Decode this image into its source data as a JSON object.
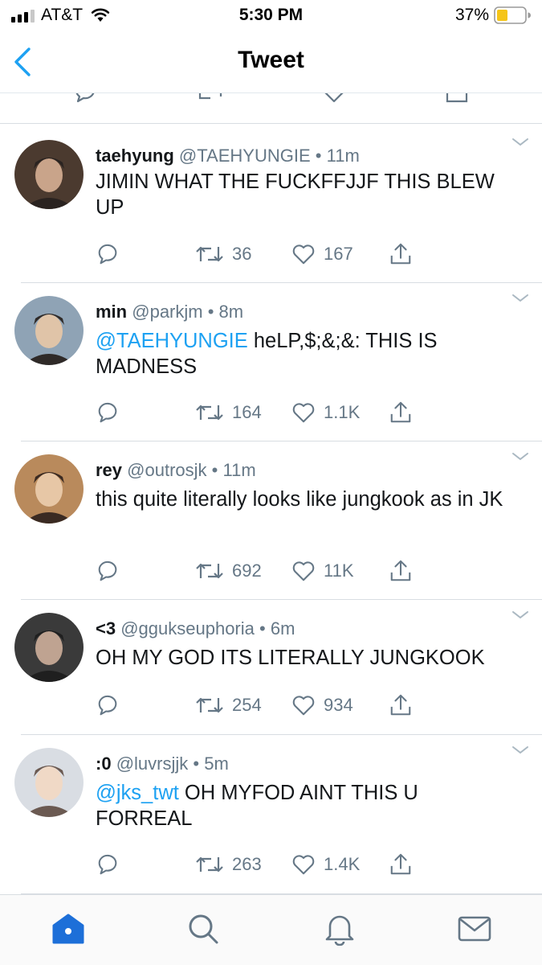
{
  "status_bar": {
    "carrier": "AT&T",
    "time": "5:30 PM",
    "battery": "37%"
  },
  "nav": {
    "title": "Tweet",
    "back_icon": "chevron-left-icon"
  },
  "colors": {
    "accent": "#1da1f2",
    "icon_blue": "#1d6fd8",
    "muted": "#657786",
    "divider": "#d8dde2",
    "battery_fill": "#f5c518"
  },
  "tweets": [
    {
      "name": "taehyung",
      "handle": "@TAEHYUNGIE",
      "sep": "•",
      "time": "11m",
      "mention": "",
      "text": "JIMIN WHAT THE FUCKFFJJF THIS BLEW UP",
      "retweets": "36",
      "likes": "167"
    },
    {
      "name": "min",
      "handle": "@parkjm",
      "sep": "•",
      "time": "8m",
      "mention": "@TAEHYUNGIE",
      "text": "heLP,$;&;&: THIS IS MADNESS",
      "retweets": "164",
      "likes": "1.1K"
    },
    {
      "name": "rey",
      "handle": "@outrosjk",
      "sep": "•",
      "time": "11m",
      "mention": "",
      "text": "this quite literally looks like jungkook as in JK",
      "retweets": "692",
      "likes": "11K"
    },
    {
      "name": "<3",
      "handle": "@ggukseuphoria",
      "sep": "•",
      "time": "6m",
      "mention": "",
      "text": "OH MY GOD ITS LITERALLY JUNGKOOK",
      "retweets": "254",
      "likes": "934"
    },
    {
      "name": ":0",
      "handle": "@luvrsjjk",
      "sep": "•",
      "time": "5m",
      "mention": "@jks_twt",
      "text": "OH MYFOD AINT THIS U FORREAL",
      "retweets": "263",
      "likes": "1.4K"
    }
  ],
  "tabbar": {
    "items": [
      "home-icon",
      "search-icon",
      "notifications-icon",
      "messages-icon"
    ],
    "active": "home-icon"
  }
}
